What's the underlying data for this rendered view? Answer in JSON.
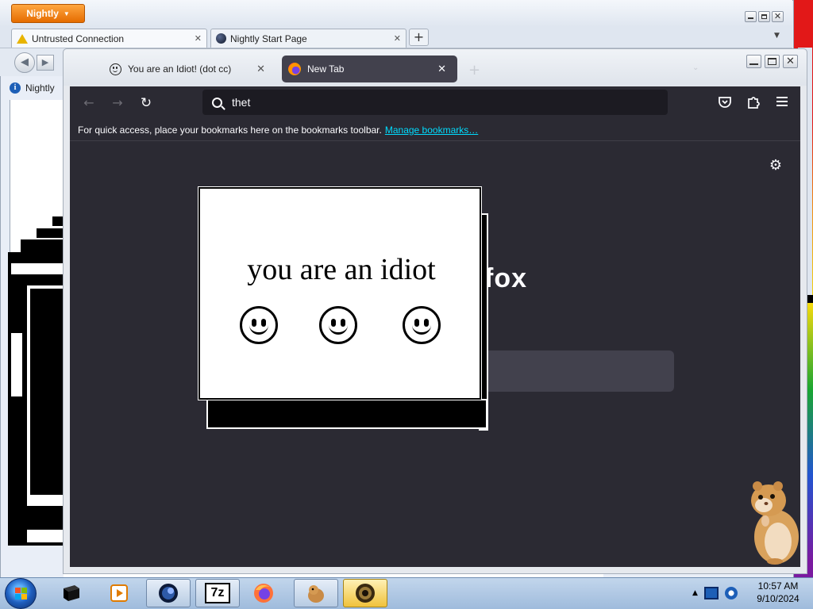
{
  "nightly": {
    "menu_label": "Nightly",
    "tabs": [
      {
        "title": "Untrusted Connection",
        "icon": "warning-icon"
      },
      {
        "title": "Nightly Start Page",
        "icon": "globe-icon"
      }
    ],
    "new_tab_label": "+",
    "bookmark_label": "Nightly"
  },
  "firefox": {
    "tabs": [
      {
        "title": "You are an Idiot! (dot cc)",
        "icon": "smiley-icon"
      },
      {
        "title": "New Tab",
        "icon": "firefox-icon",
        "active": true
      }
    ],
    "new_tab_label": "+",
    "url_text": "thet",
    "bookmarks_bar": {
      "message": "For quick access, place your bookmarks here on the bookmarks toolbar.",
      "link": "Manage bookmarks…"
    },
    "brand_fragment": "fox",
    "colors": {
      "toolbar": "#2b2a33",
      "tab_active": "#42414d",
      "link": "#00ddff"
    }
  },
  "popup": {
    "text": "you are an idiot",
    "faces": 3
  },
  "taskbar": {
    "apps": [
      "command-prompt-icon",
      "media-player-icon",
      "firefox-nightly-icon",
      "7zip-icon",
      "firefox-icon",
      "hamster-app-icon",
      "idiot-app-icon"
    ],
    "sevenzip_label": "7z",
    "clock": {
      "time": "10:57 AM",
      "date": "9/10/2024"
    }
  }
}
